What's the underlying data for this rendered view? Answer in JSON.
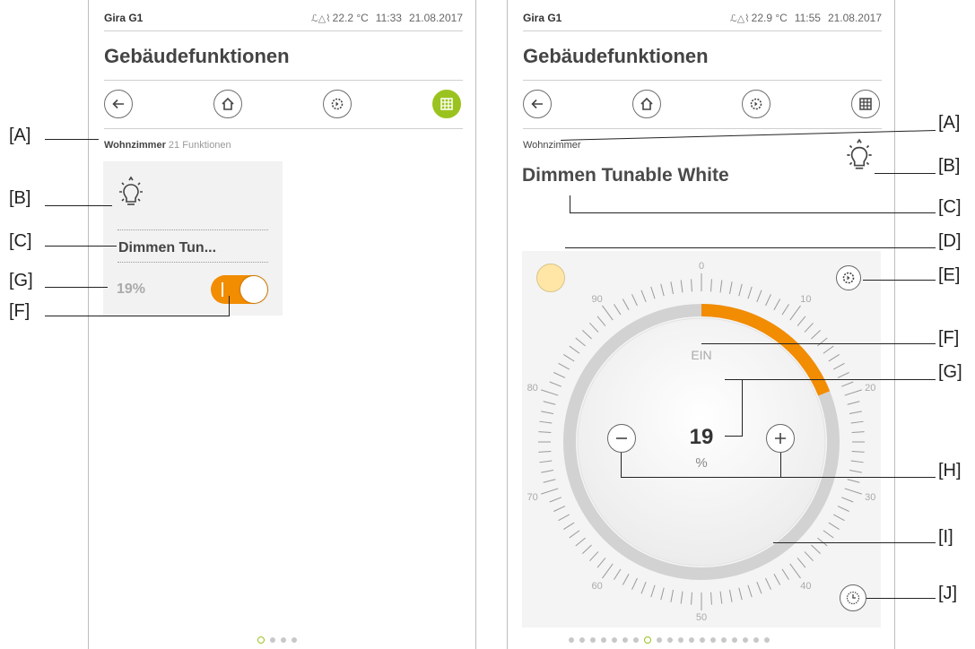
{
  "left": {
    "device": "Gira G1",
    "temp": "22.2 °C",
    "time": "11:33",
    "date": "21.08.2017",
    "title": "Gebäudefunktionen",
    "room": "Wohnzimmer",
    "count": "21",
    "count_label": "Funktionen",
    "tile_name": "Dimmen Tun...",
    "tile_value": "19%",
    "switch_on": true,
    "pager_count": 4,
    "pager_active": 0
  },
  "right": {
    "device": "Gira G1",
    "temp": "22.9 °C",
    "time": "11:55",
    "date": "21.08.2017",
    "title": "Gebäudefunktionen",
    "room": "Wohnzimmer",
    "function_name": "Dimmen Tunable White",
    "state": "EIN",
    "value": "19",
    "unit": "%",
    "dial_fraction": 0.19,
    "color_swatch": "#ffe6a6",
    "ticks": [
      "0",
      "10",
      "20",
      "30",
      "40",
      "50",
      "60",
      "70",
      "80",
      "90"
    ],
    "pager_count": 19,
    "pager_active": 7
  },
  "callouts_left": [
    "[A]",
    "[B]",
    "[C]",
    "[G]",
    "[F]"
  ],
  "callouts_right": [
    "[A]",
    "[B]",
    "[C]",
    "[D]",
    "[E]",
    "[F]",
    "[G]",
    "[H]",
    "[I]",
    "[J]"
  ],
  "colors": {
    "accent_green": "#9bc31f",
    "accent_orange": "#f28c00"
  },
  "icons": [
    "back-arrow-icon",
    "home-icon",
    "gear-icon",
    "grid-icon",
    "bulb-icon",
    "minus-icon",
    "plus-icon",
    "clock-icon",
    "thermometer-icon"
  ]
}
